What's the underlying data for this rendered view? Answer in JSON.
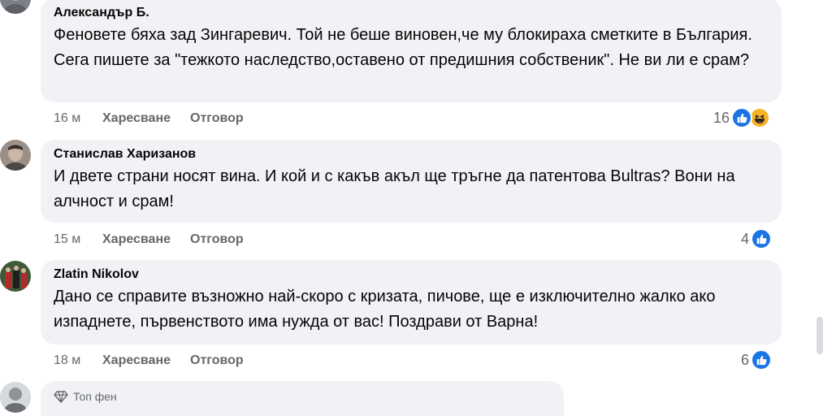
{
  "comments": [
    {
      "author": "Александър Б.",
      "text": "Феновете бяха зад Зингаревич. Той не беше виновен,че му блокираха сметките в България. Сега пишете за \"тежкото наследство,оставено от предишния собственик\". Не ви ли е срам?",
      "time": "16 м",
      "like_label": "Харесване",
      "reply_label": "Отговор",
      "reaction_count": "16",
      "reactions": [
        "like-icon",
        "haha-icon"
      ]
    },
    {
      "author": "Станислав Харизанов",
      "text": "И двете страни носят вина. И кой и с какъв акъл ще тръгне да патентова Bultras? Вони на алчност и срам!",
      "time": "15 м",
      "like_label": "Харесване",
      "reply_label": "Отговор",
      "reaction_count": "4",
      "reactions": [
        "like-icon"
      ]
    },
    {
      "author": "Zlatin Nikolov",
      "text": "Дано се справите възножно най-скоро с кризата, пичове, ще е изключително жалко ако изпаднете, първенството има нужда от вас! Поздрави от Варна!",
      "time": "18 м",
      "like_label": "Харесване",
      "reply_label": "Отговор",
      "reaction_count": "6",
      "reactions": [
        "like-icon"
      ]
    },
    {
      "badge": "Топ фен",
      "badge_icon": "diamond-icon"
    }
  ],
  "colors": {
    "bubble": "#f0f2f5",
    "meta_text": "#65676b",
    "like_blue": "#1b74e4",
    "haha_yellow": "#f7b125"
  }
}
